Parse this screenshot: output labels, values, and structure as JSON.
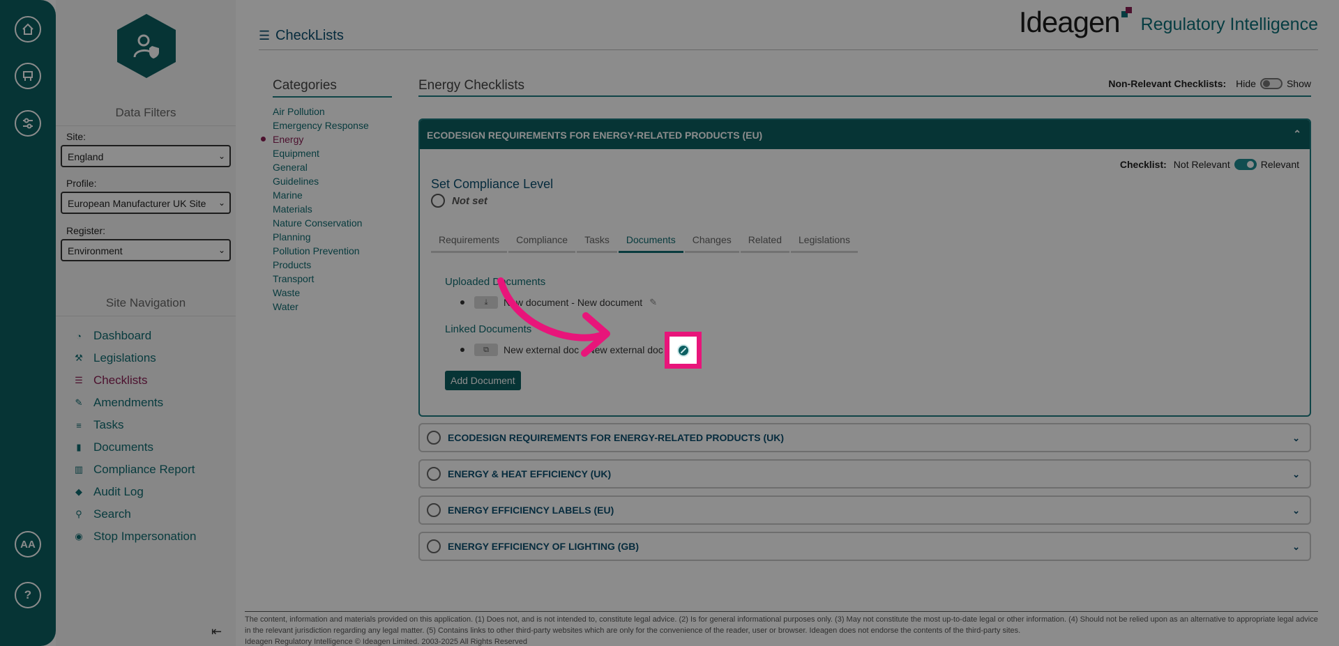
{
  "rail": {
    "bottom_label": "AA",
    "help_label": "?"
  },
  "sidebar": {
    "data_filters_title": "Data Filters",
    "site_label": "Site:",
    "site_value": "England",
    "profile_label": "Profile:",
    "profile_value": "European Manufacturer UK Site",
    "register_label": "Register:",
    "register_value": "Environment",
    "site_nav_title": "Site Navigation",
    "nav": [
      {
        "label": "Dashboard",
        "icon": "dashboard-icon"
      },
      {
        "label": "Legislations",
        "icon": "gavel-icon"
      },
      {
        "label": "Checklists",
        "icon": "list-icon"
      },
      {
        "label": "Amendments",
        "icon": "edit-icon"
      },
      {
        "label": "Tasks",
        "icon": "tasks-icon"
      },
      {
        "label": "Documents",
        "icon": "file-icon"
      },
      {
        "label": "Compliance Report",
        "icon": "chart-icon"
      },
      {
        "label": "Audit Log",
        "icon": "tags-icon"
      },
      {
        "label": "Search",
        "icon": "search-icon"
      },
      {
        "label": "Stop Impersonation",
        "icon": "stop-icon"
      }
    ],
    "active_nav": "Checklists"
  },
  "header": {
    "page_title": "CheckLists",
    "brand_name": "Ideagen",
    "brand_sub": "Regulatory Intelligence"
  },
  "categories": {
    "title": "Categories",
    "items": [
      "Air Pollution",
      "Emergency Response",
      "Energy",
      "Equipment",
      "General",
      "Guidelines",
      "Marine",
      "Materials",
      "Nature Conservation",
      "Planning",
      "Pollution Prevention",
      "Products",
      "Transport",
      "Waste",
      "Water"
    ],
    "active": "Energy"
  },
  "main": {
    "title": "Energy Checklists",
    "non_relevant_label": "Non-Relevant Checklists:",
    "hide_label": "Hide",
    "show_label": "Show",
    "panel": {
      "title": "ECODESIGN REQUIREMENTS FOR ENERGY-RELATED PRODUCTS (EU)",
      "checklist_label": "Checklist:",
      "not_relevant_label": "Not Relevant",
      "relevant_label": "Relevant",
      "compliance_title": "Set Compliance Level",
      "compliance_value": "Not set",
      "tabs": [
        "Requirements",
        "Compliance",
        "Tasks",
        "Documents",
        "Changes",
        "Related",
        "Legislations"
      ],
      "active_tab": "Documents",
      "uploaded_title": "Uploaded Documents",
      "uploaded_doc": "New document - New document",
      "linked_title": "Linked Documents",
      "linked_doc": "New external doc - New external doc",
      "add_button": "Add Document"
    },
    "accordions": [
      "ECODESIGN REQUIREMENTS FOR ENERGY-RELATED PRODUCTS (UK)",
      "ENERGY & HEAT EFFICIENCY (UK)",
      "ENERGY EFFICIENCY LABELS (EU)",
      "ENERGY EFFICIENCY OF LIGHTING (GB)"
    ]
  },
  "footer": {
    "disclaimer": "The content, information and materials provided on this application. (1) Does not, and is not intended to, constitute legal advice. (2) Is for general informational purposes only. (3) May not constitute the most up-to-date legal or other information. (4) Should not be relied upon as an alternative to appropriate legal advice in the relevant jurisdiction regarding any legal matter. (5) Contains links to other third-party websites which are only for the convenience of the reader, user or browser. Ideagen does not endorse the contents of the third-party sites.",
    "copyright": "Ideagen Regulatory Intelligence © Ideagen Limited. 2003-2025 All Rights Reserved"
  },
  "colors": {
    "teal": "#0c5f62",
    "accent_link": "#0f6c72",
    "active_magenta": "#8a1f55",
    "highlight_pink": "#e8157a"
  }
}
